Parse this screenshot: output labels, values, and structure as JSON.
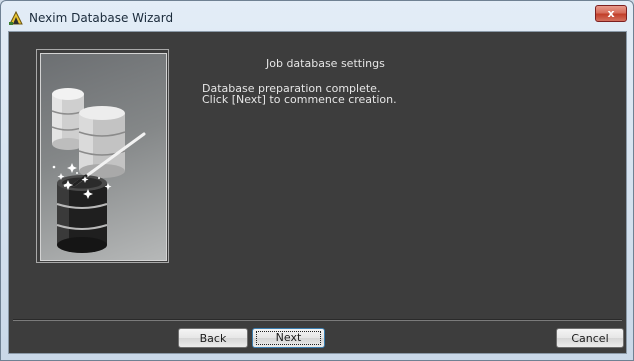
{
  "window": {
    "title": "Nexim Database Wizard",
    "close_label": "x"
  },
  "wizard": {
    "step_title": "Job database settings",
    "message_line1": "Database preparation complete.",
    "message_line2": "Click [Next] to commence creation.",
    "illustration_icon": "database-wand-illustration"
  },
  "buttons": {
    "back": "Back",
    "next": "Next",
    "cancel": "Cancel"
  },
  "colors": {
    "panel_background": "#3d3d3d",
    "text": "#e6e6e6",
    "close_button": "#c23f2a"
  }
}
